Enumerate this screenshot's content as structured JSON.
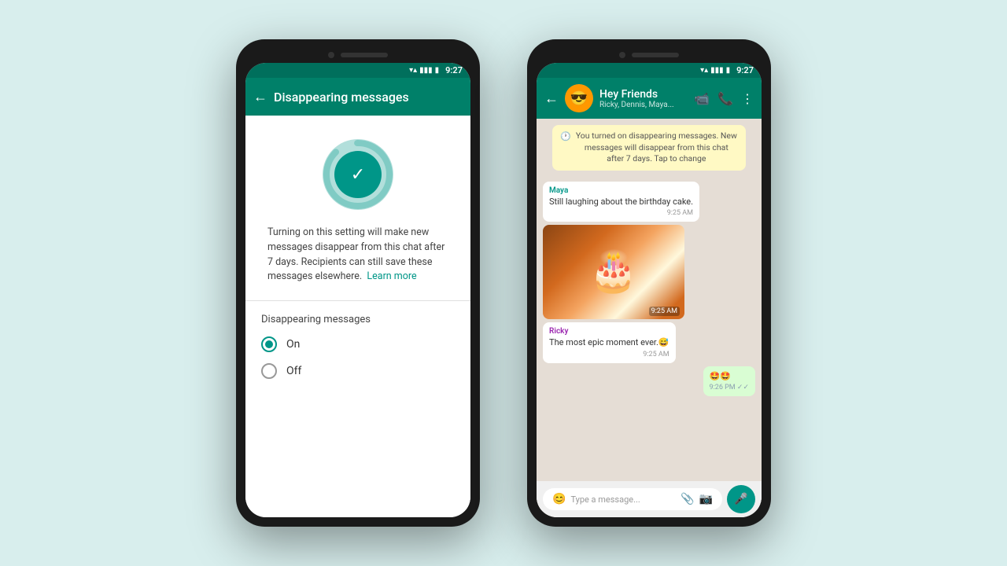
{
  "background_color": "#d8eeed",
  "phone_left": {
    "status_bar": {
      "time": "9:27"
    },
    "header": {
      "title": "Disappearing messages",
      "back_label": "←"
    },
    "description": "Turning on this setting will make new messages disappear from this chat after 7 days. Recipients can still save these messages elsewhere.",
    "learn_more_label": "Learn more",
    "options_title": "Disappearing messages",
    "option_on_label": "On",
    "option_off_label": "Off",
    "option_on_selected": true
  },
  "phone_right": {
    "status_bar": {
      "time": "9:27"
    },
    "header": {
      "group_name": "Hey Friends",
      "members": "Ricky, Dennis, Maya...",
      "back_label": "←"
    },
    "system_notification": "You turned on disappearing messages. New messages will disappear from this chat after 7 days. Tap to change",
    "messages": [
      {
        "id": 1,
        "type": "received",
        "sender": "Maya",
        "sender_color": "#009688",
        "text": "Still laughing about the birthday cake.",
        "time": "9:25 AM"
      },
      {
        "id": 2,
        "type": "received_image",
        "sender": null,
        "time": "9:25 AM"
      },
      {
        "id": 3,
        "type": "received",
        "sender": "Ricky",
        "sender_color": "#9c27b0",
        "text": "The most epic moment ever.😅",
        "time": "9:25 AM"
      },
      {
        "id": 4,
        "type": "sent",
        "text": "🤩🤩",
        "time": "9:26 PM",
        "read": true
      }
    ],
    "input_placeholder": "Type a message..."
  },
  "icons": {
    "back_arrow": "←",
    "video_call": "📹",
    "voice_call": "📞",
    "more_options": "⋮",
    "emoji": "😊",
    "attachment": "📎",
    "camera": "📷",
    "mic": "🎤",
    "wifi": "▲",
    "signal": "▲",
    "battery": "▮"
  }
}
